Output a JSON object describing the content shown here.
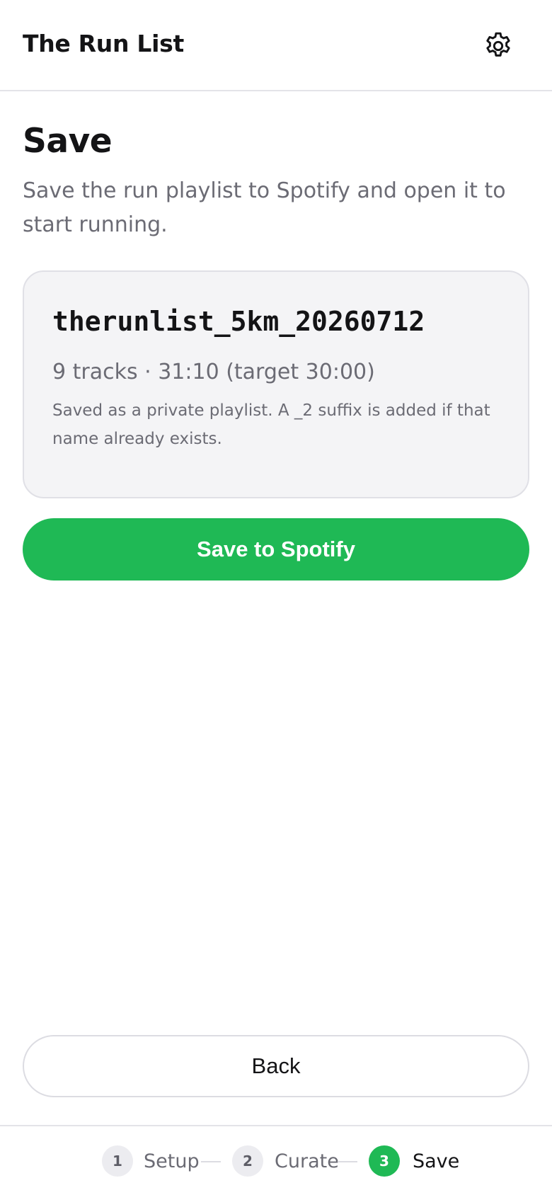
{
  "header": {
    "title": "The Run List",
    "settings_icon": "gear-icon"
  },
  "page": {
    "title": "Save",
    "description": "Save the run playlist to Spotify and open it to start running."
  },
  "playlist": {
    "name": "therunlist_5km_20260712",
    "meta": "9 tracks · 31:10 (target 30:00)",
    "note": "Saved as a private playlist. A _2 suffix is added if that name already exists."
  },
  "actions": {
    "save_label": "Save to Spotify",
    "back_label": "Back"
  },
  "stepper": {
    "steps": [
      {
        "number": "1",
        "label": "Setup",
        "state": "done"
      },
      {
        "number": "2",
        "label": "Curate",
        "state": "done"
      },
      {
        "number": "3",
        "label": "Save",
        "state": "active"
      }
    ]
  },
  "colors": {
    "accent": "#1fb955",
    "text": "#141416",
    "muted": "#6b6b74",
    "card_bg": "#f4f4f6"
  }
}
